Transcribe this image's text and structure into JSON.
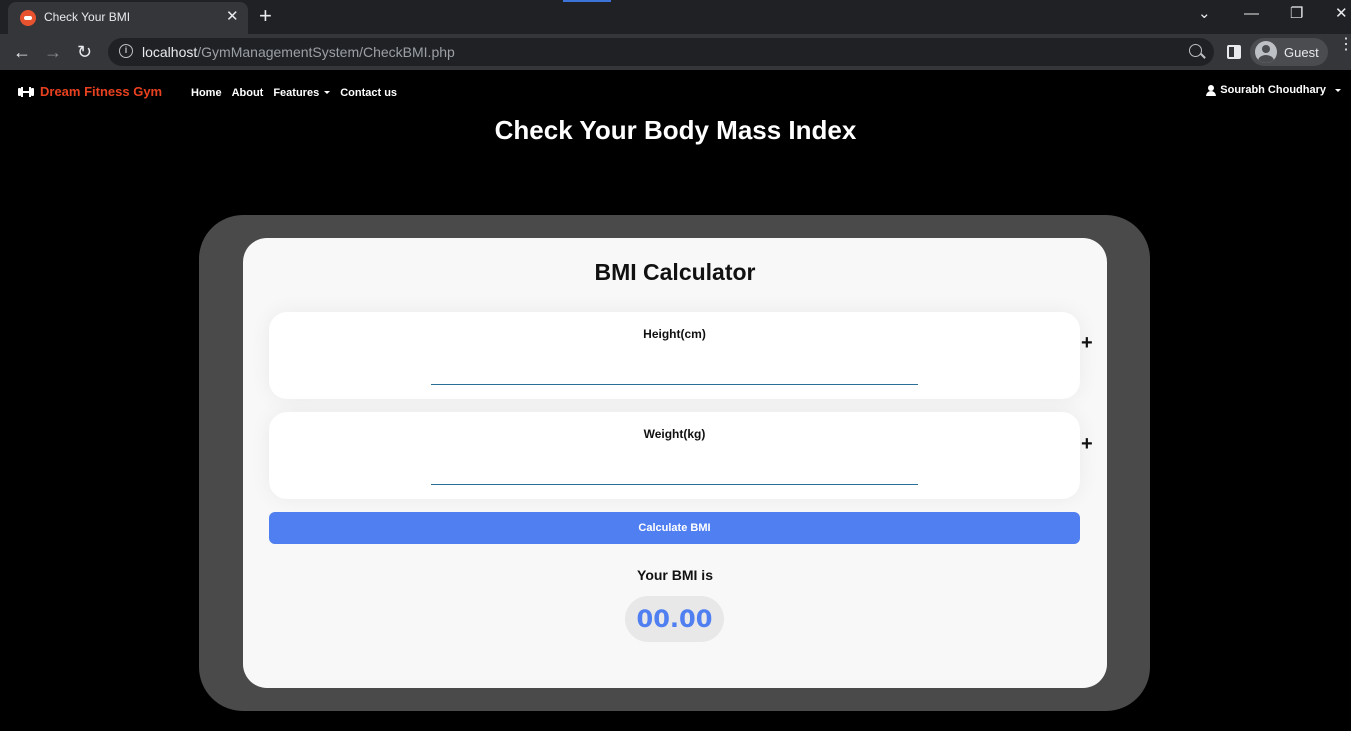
{
  "browser": {
    "tab_title": "Check Your BMI",
    "tab_close": "✕",
    "new_tab": "+",
    "url_host": "localhost",
    "url_path": "/GymManagementSystem/CheckBMI.php",
    "profile_label": "Guest",
    "back_icon": "←",
    "forward_icon": "→",
    "reload_icon": "↻",
    "tabs_menu_icon": "⌄",
    "minimize_icon": "—",
    "restore_icon": "❐",
    "close_icon": "✕",
    "menu_icon": "⋮"
  },
  "navbar": {
    "brand": "Dream Fitness Gym",
    "links": [
      {
        "label": "Home"
      },
      {
        "label": "About"
      },
      {
        "label": "Features"
      },
      {
        "label": "Contact us"
      }
    ],
    "user": "Sourabh Choudhary"
  },
  "page": {
    "title": "Check Your Body Mass Index"
  },
  "calculator": {
    "title": "BMI Calculator",
    "height_label": "Height(cm)",
    "height_value": "",
    "weight_label": "Weight(kg)",
    "weight_value": "",
    "plus_symbol": "+",
    "button_label": "Calculate BMI",
    "result_label": "Your BMI is",
    "result_value": "00.00"
  },
  "colors": {
    "brand": "#e8411f",
    "button": "#4f7ff0",
    "result_text": "#4f7ff0",
    "outer_card": "#4a4a4a",
    "inner_card": "#f8f8f8"
  }
}
